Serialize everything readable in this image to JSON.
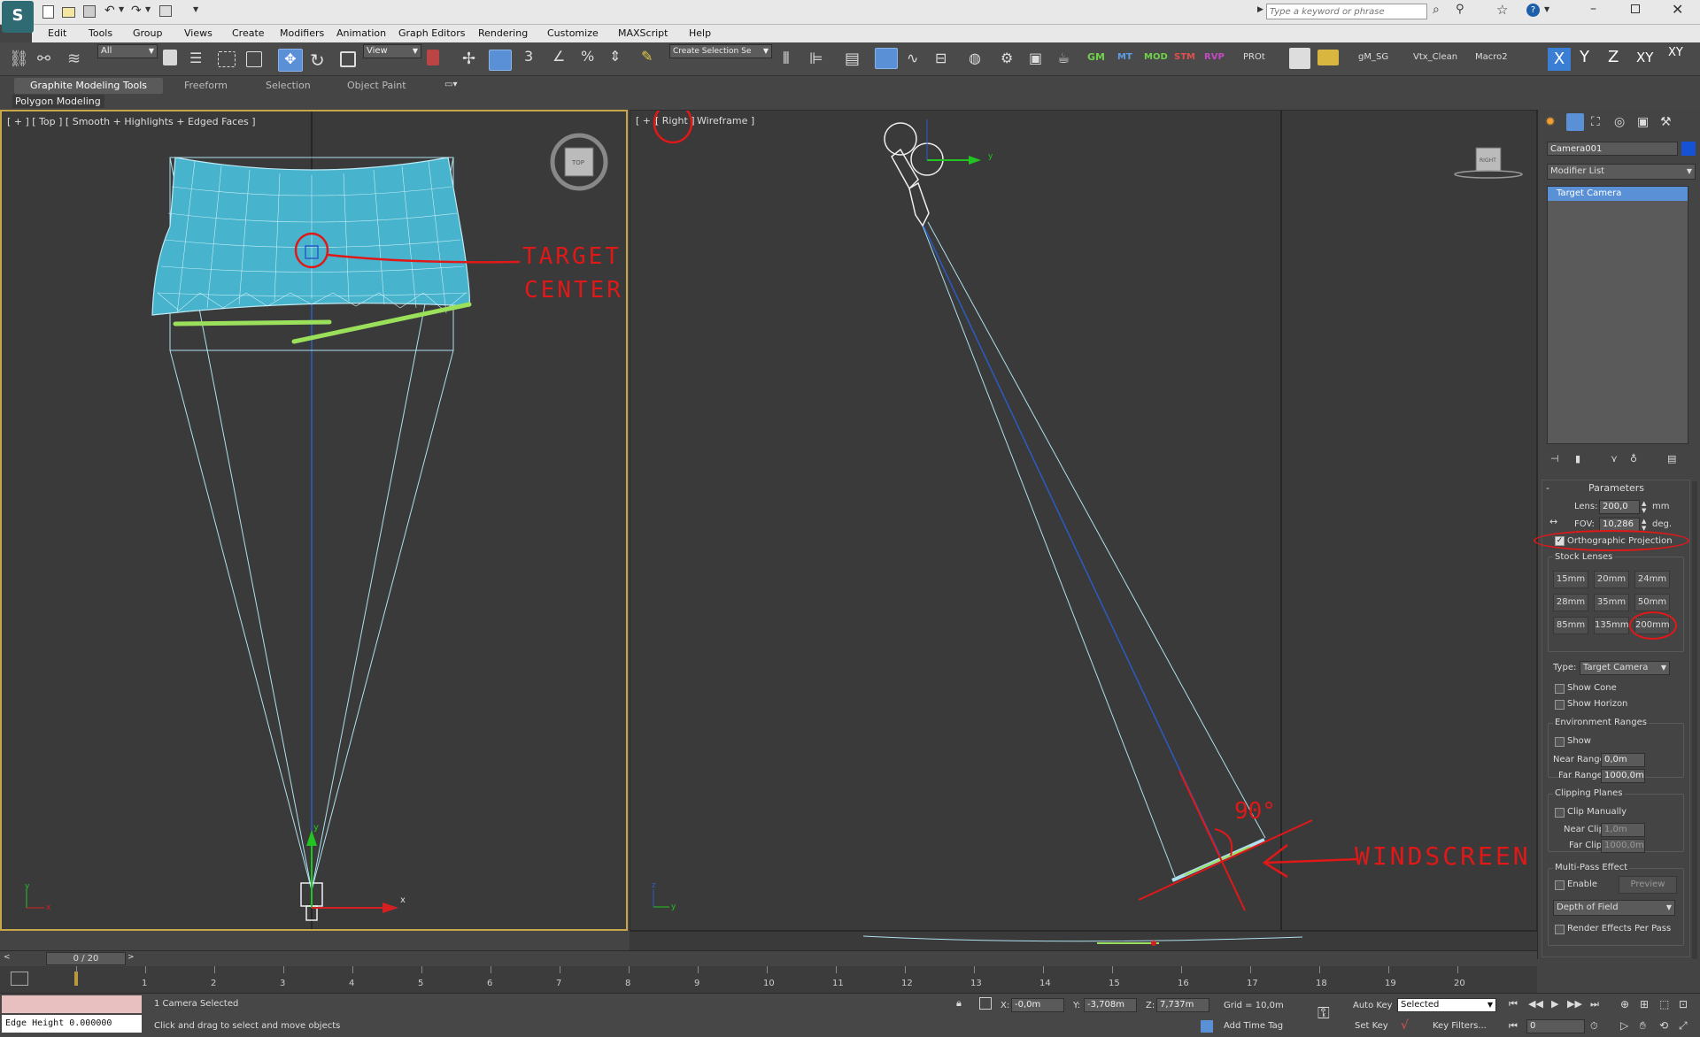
{
  "window": {
    "search_placeholder": "Type a keyword or phrase"
  },
  "menu": {
    "items": [
      "Edit",
      "Tools",
      "Group",
      "Views",
      "Create",
      "Modifiers",
      "Animation",
      "Graph Editors",
      "Rendering",
      "Customize",
      "MAXScript",
      "Help"
    ]
  },
  "toolbar": {
    "selection_filter": "All",
    "ref_coord": "View",
    "named_selection": "Create Selection Se",
    "scripts": [
      "GM",
      "MT",
      "MOD",
      "STM",
      "RVP",
      "PROt",
      "gM_SG",
      "Vtx_Clean",
      "Macro2"
    ],
    "axis": [
      "X",
      "Y",
      "Z",
      "XY",
      "XY"
    ]
  },
  "ribbon": {
    "tabs": [
      "Graphite Modeling Tools",
      "Freeform",
      "Selection",
      "Object Paint"
    ],
    "sub": "Polygon Modeling"
  },
  "viewports": {
    "left": {
      "label": "[ + ] [ Top ] [ Smooth + Highlights + Edged Faces ]",
      "cube": "TOP",
      "axis_x": "x",
      "axis_y": "y",
      "annot": [
        "TARGET",
        "CENTER"
      ]
    },
    "right": {
      "label_plus": "[ + ]",
      "label_view": "[ Right ]",
      "label_mode": "Wireframe ]",
      "cube": "RIGHT",
      "axis_y": "y",
      "axis_z": "z",
      "annot_angle": "90°",
      "annot_text": "WINDSCREEN"
    }
  },
  "panel": {
    "object_name": "Camera001",
    "modifier_list": "Modifier List",
    "stack": [
      "Target Camera"
    ],
    "rollout": "Parameters",
    "lens_label": "Lens:",
    "lens_value": "200,0",
    "lens_unit": "mm",
    "fov_label": "FOV:",
    "fov_value": "10,286",
    "fov_unit": "deg.",
    "ortho": "Orthographic Projection",
    "stock_lenses": "Stock Lenses",
    "lenses": [
      "15mm",
      "20mm",
      "24mm",
      "28mm",
      "35mm",
      "50mm",
      "85mm",
      "135mm",
      "200mm"
    ],
    "type_label": "Type:",
    "type_value": "Target Camera",
    "show_cone": "Show Cone",
    "show_horizon": "Show Horizon",
    "env_ranges": "Environment Ranges",
    "env_show": "Show",
    "near_range_label": "Near Range:",
    "near_range": "0,0m",
    "far_range_label": "Far Range:",
    "far_range": "1000,0m",
    "clipping": "Clipping Planes",
    "clip_manually": "Clip Manually",
    "near_clip_label": "Near Clip:",
    "near_clip": "1,0m",
    "far_clip_label": "Far Clip:",
    "far_clip": "1000,0m",
    "multipass": "Multi-Pass Effect",
    "enable": "Enable",
    "preview": "Preview",
    "effect": "Depth of Field",
    "render_per_pass": "Render Effects Per Pass"
  },
  "timeline": {
    "frame": "0 / 20",
    "ticks": [
      "1",
      "2",
      "3",
      "4",
      "5",
      "6",
      "7",
      "8",
      "9",
      "10",
      "11",
      "12",
      "13",
      "14",
      "15",
      "16",
      "17",
      "18",
      "19",
      "20"
    ]
  },
  "status": {
    "listener": "Edge Height 0.000000",
    "selected": "1 Camera Selected",
    "prompt": "Click and drag to select and move objects",
    "x_label": "X:",
    "x": "-0,0m",
    "y_label": "Y:",
    "y": "-3,708m",
    "z_label": "Z:",
    "z": "7,737m",
    "grid": "Grid = 10,0m",
    "add_time_tag": "Add Time Tag",
    "auto_key": "Auto Key",
    "set_key": "Set Key",
    "key_mode": "Selected",
    "key_filters": "Key Filters...",
    "frame_field": "0"
  }
}
